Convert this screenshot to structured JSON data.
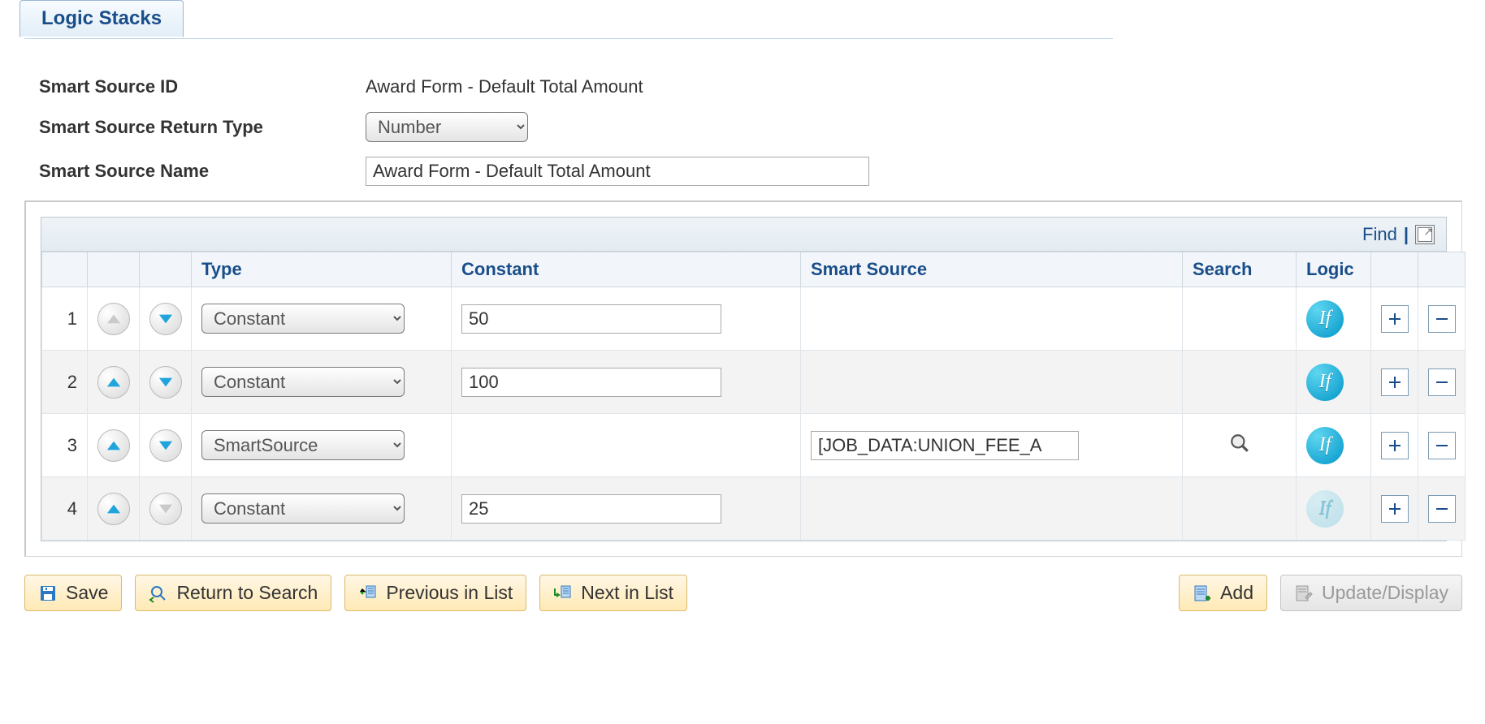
{
  "tab": {
    "label": "Logic Stacks"
  },
  "fields": {
    "smart_source_id_label": "Smart Source ID",
    "smart_source_id_value": "Award Form - Default Total Amount",
    "return_type_label": "Smart Source Return Type",
    "return_type_value": "Number",
    "name_label": "Smart Source Name",
    "name_value": "Award Form - Default Total Amount"
  },
  "grid": {
    "find_label": "Find",
    "columns": {
      "type": "Type",
      "constant": "Constant",
      "smart_source": "Smart Source",
      "search": "Search",
      "logic": "Logic"
    },
    "rows": [
      {
        "n": "1",
        "up_enabled": false,
        "down_enabled": true,
        "type": "Constant",
        "constant": "50",
        "smart_source": "",
        "search": false,
        "logic_enabled": true
      },
      {
        "n": "2",
        "up_enabled": true,
        "down_enabled": true,
        "type": "Constant",
        "constant": "100",
        "smart_source": "",
        "search": false,
        "logic_enabled": true
      },
      {
        "n": "3",
        "up_enabled": true,
        "down_enabled": true,
        "type": "SmartSource",
        "constant": "",
        "smart_source": "[JOB_DATA:UNION_FEE_A",
        "search": true,
        "logic_enabled": true
      },
      {
        "n": "4",
        "up_enabled": true,
        "down_enabled": false,
        "type": "Constant",
        "constant": "25",
        "smart_source": "",
        "search": false,
        "logic_enabled": false
      }
    ],
    "if_label": "If"
  },
  "actions": {
    "save": "Save",
    "return_to_search": "Return to Search",
    "previous_in_list": "Previous in List",
    "next_in_list": "Next in List",
    "add": "Add",
    "update_display": "Update/Display"
  }
}
